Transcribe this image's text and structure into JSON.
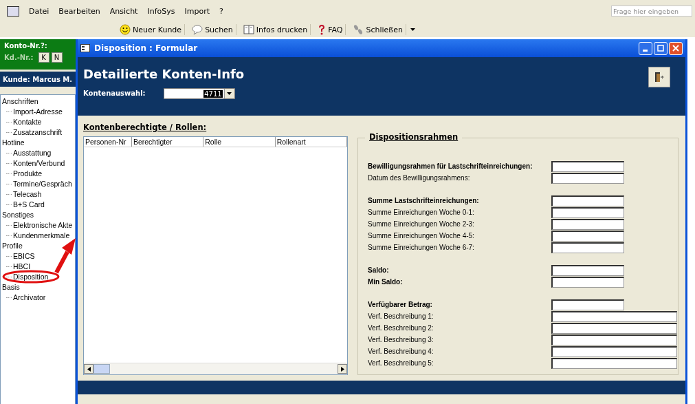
{
  "menu_bar": {
    "items": [
      "Datei",
      "Bearbeiten",
      "Ansicht",
      "InfoSys",
      "Import",
      "?"
    ],
    "help_search": {
      "placeholder": "Frage hier eingeben"
    }
  },
  "toolbar": {
    "buttons": [
      {
        "label": "Neuer Kunde",
        "kind": "smiley"
      },
      {
        "label": "Suchen",
        "kind": "speech"
      },
      {
        "label": "Infos drucken",
        "kind": "book"
      },
      {
        "label": "FAQ",
        "kind": "question"
      },
      {
        "label": "Schließen",
        "kind": "steps"
      }
    ]
  },
  "left_panel": {
    "konto_label": "Konto-Nr.?:",
    "kd_label": "Kd.-Nr.:",
    "kd_buttons": [
      "K",
      "N"
    ],
    "customer": "Kunde: Marcus M.",
    "tree": [
      {
        "label": "Anschriften",
        "children": [
          {
            "label": "Import-Adresse"
          },
          {
            "label": "Kontakte"
          },
          {
            "label": "Zusatzanschrift"
          }
        ]
      },
      {
        "label": "Hotline",
        "children": [
          {
            "label": "Ausstattung"
          },
          {
            "label": "Konten/Verbund"
          },
          {
            "label": "Produkte"
          },
          {
            "label": "Termine/Gespräch"
          },
          {
            "label": "Telecash"
          },
          {
            "label": "B+S Card"
          }
        ]
      },
      {
        "label": "Sonstiges",
        "children": [
          {
            "label": "Elektronische Akte"
          },
          {
            "label": "Kundenmerkmale"
          }
        ]
      },
      {
        "label": "Profile",
        "children": [
          {
            "label": "EBICS"
          },
          {
            "label": "HBCI"
          },
          {
            "label": "Disposition"
          }
        ]
      },
      {
        "label": "Basis",
        "children": [
          {
            "label": "Archivator"
          }
        ]
      }
    ]
  },
  "window": {
    "title": "Disposition : Formular",
    "heading": "Detailierte Konten-Info",
    "account_select": {
      "label": "Kontenauswahl:",
      "value": "4711"
    },
    "roles": {
      "title": "Kontenberechtigte / Rollen:",
      "columns": [
        "Personen-Nr",
        "Berechtigter",
        "Rolle",
        "Rollenart"
      ]
    },
    "disposition": {
      "title": "Dispositionsrahmen",
      "groups": [
        [
          {
            "label": "Bewilligungsrahmen für Lastschrifteinreichungen:",
            "kind": "heading",
            "wide": false
          },
          {
            "label": "Datum des Bewilligungsrahmens:",
            "kind": "item",
            "wide": false
          }
        ],
        [
          {
            "label": "Summe Lastschrifteinreichungen:",
            "kind": "heading",
            "wide": false
          },
          {
            "label": "Summe Einreichungen Woche 0-1:",
            "kind": "item",
            "wide": false
          },
          {
            "label": "Summe Einreichungen Woche 2-3:",
            "kind": "item",
            "wide": false
          },
          {
            "label": "Summe Einreichungen Woche 4-5:",
            "kind": "item",
            "wide": false
          },
          {
            "label": "Summe Einreichungen Woche 6-7:",
            "kind": "item",
            "wide": false
          }
        ],
        [
          {
            "label": "Saldo:",
            "kind": "heading",
            "wide": false
          },
          {
            "label": "Min Saldo:",
            "kind": "heading",
            "wide": false
          }
        ],
        [
          {
            "label": "Verfügbarer Betrag:",
            "kind": "heading",
            "wide": false
          },
          {
            "label": "Verf. Beschreibung 1:",
            "kind": "item",
            "wide": true
          },
          {
            "label": "Verf. Beschreibung 2:",
            "kind": "item",
            "wide": true
          },
          {
            "label": "Verf. Beschreibung 3:",
            "kind": "item",
            "wide": true
          },
          {
            "label": "Verf. Beschreibung 4:",
            "kind": "item",
            "wide": true
          },
          {
            "label": "Verf. Beschreibung 5:",
            "kind": "item",
            "wide": true
          }
        ]
      ]
    }
  }
}
